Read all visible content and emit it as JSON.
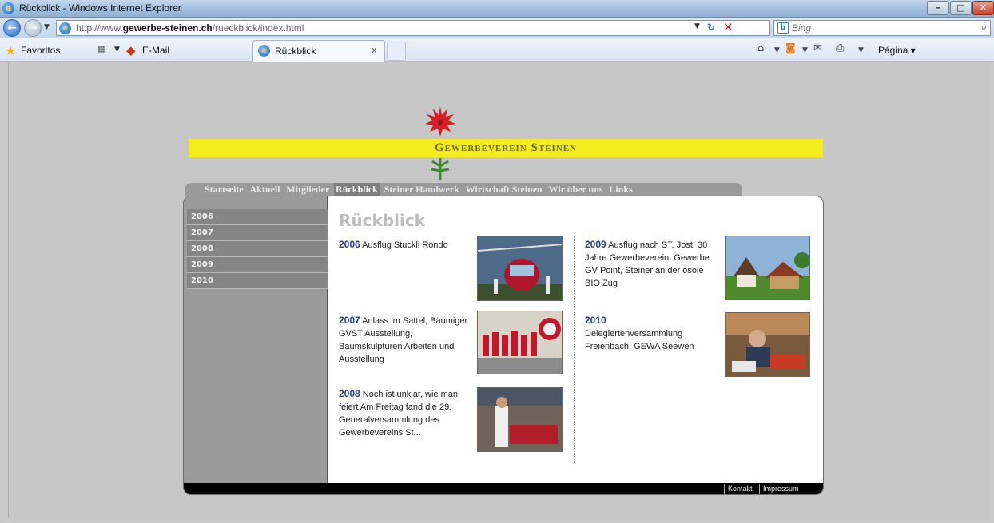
{
  "window": {
    "title": "Rückblick - Windows Internet Explorer"
  },
  "address": {
    "url_prefix": "http://www.",
    "url_domain": "gewerbe-steinen.ch",
    "url_path": "/rueckblick/index.html",
    "search_placeholder": "Bing"
  },
  "favorites": {
    "favorites_label": "Favoritos",
    "email_label": "E-Mail",
    "tab_label": "Rückblick",
    "tab_close": "x",
    "page_menu_label": "Página"
  },
  "site": {
    "title": "Gewerbeverein Steinen",
    "nav": [
      "Startseite",
      "Aktuell",
      "Mitglieder",
      "Rückblick",
      "Steiner Handwerk",
      "Wirtschaft Steinen",
      "Wir über uns",
      "Links"
    ],
    "nav_active": "Rückblick",
    "years": [
      "2006",
      "2007",
      "2008",
      "2009",
      "2010"
    ],
    "heading": "Rückblick",
    "entries": [
      {
        "year": "2006",
        "text": "Ausflug Stuckli Rondo"
      },
      {
        "year": "2007",
        "text": "Anlass im Sattel, Bäumiger GVST Ausstellung, Baumskulpturen Arbeiten und Ausstellung"
      },
      {
        "year": "2008",
        "text": "Noch ist unklar, wie man feiert Am Freitag fand die 29. Generalversammlung des Gewerbevereins St..."
      },
      {
        "year": "2009",
        "text": "Ausflug nach ST. Jost, 30 Jahre Gewerbeverein, Gewerbe GV Point, Steiner an der osole BIO Zug"
      },
      {
        "year": "2010",
        "text": "Delegiertenversammlung Freienbach, GEWA Seewen"
      }
    ],
    "footer": {
      "contact": "Kontakt",
      "imprint": "Impressum"
    }
  },
  "colors": {
    "banner": "#f5ec1e",
    "sidebar": "#9b9b9b",
    "year_link": "#2a3f80",
    "footer": "#000000"
  }
}
